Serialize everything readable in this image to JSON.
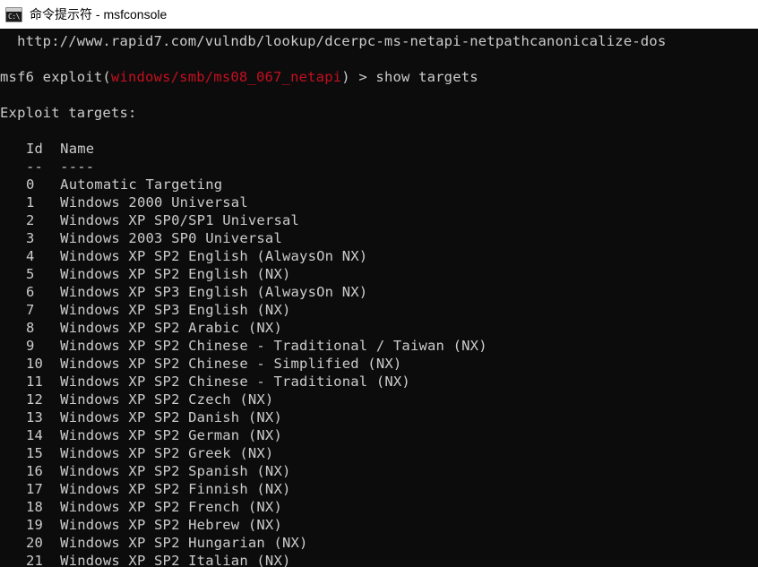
{
  "window": {
    "title": "命令提示符 - msfconsole",
    "icon": "cmd-icon",
    "icon_prompt_glyph": "C:\\",
    "titlebar_bg": "#ffffff",
    "titlebar_fg": "#000000"
  },
  "terminal": {
    "background": "#0c0c0c",
    "foreground": "#cccccc",
    "accent_red": "#c50f1f",
    "url_line": "  http://www.rapid7.com/vulndb/lookup/dcerpc-ms-netapi-netpathcanonicalize-dos",
    "prompt": {
      "prefix": "msf6 exploit(",
      "module": "windows/smb/ms08_067_netapi",
      "suffix": ") > ",
      "command": "show targets"
    },
    "section_title": "Exploit targets:",
    "table": {
      "headers": [
        "Id",
        "Name"
      ],
      "separators": [
        "--",
        "----"
      ],
      "rows": [
        {
          "id": "0",
          "name": "Automatic Targeting"
        },
        {
          "id": "1",
          "name": "Windows 2000 Universal"
        },
        {
          "id": "2",
          "name": "Windows XP SP0/SP1 Universal"
        },
        {
          "id": "3",
          "name": "Windows 2003 SP0 Universal"
        },
        {
          "id": "4",
          "name": "Windows XP SP2 English (AlwaysOn NX)"
        },
        {
          "id": "5",
          "name": "Windows XP SP2 English (NX)"
        },
        {
          "id": "6",
          "name": "Windows XP SP3 English (AlwaysOn NX)"
        },
        {
          "id": "7",
          "name": "Windows XP SP3 English (NX)"
        },
        {
          "id": "8",
          "name": "Windows XP SP2 Arabic (NX)"
        },
        {
          "id": "9",
          "name": "Windows XP SP2 Chinese - Traditional / Taiwan (NX)"
        },
        {
          "id": "10",
          "name": "Windows XP SP2 Chinese - Simplified (NX)"
        },
        {
          "id": "11",
          "name": "Windows XP SP2 Chinese - Traditional (NX)"
        },
        {
          "id": "12",
          "name": "Windows XP SP2 Czech (NX)"
        },
        {
          "id": "13",
          "name": "Windows XP SP2 Danish (NX)"
        },
        {
          "id": "14",
          "name": "Windows XP SP2 German (NX)"
        },
        {
          "id": "15",
          "name": "Windows XP SP2 Greek (NX)"
        },
        {
          "id": "16",
          "name": "Windows XP SP2 Spanish (NX)"
        },
        {
          "id": "17",
          "name": "Windows XP SP2 Finnish (NX)"
        },
        {
          "id": "18",
          "name": "Windows XP SP2 French (NX)"
        },
        {
          "id": "19",
          "name": "Windows XP SP2 Hebrew (NX)"
        },
        {
          "id": "20",
          "name": "Windows XP SP2 Hungarian (NX)"
        },
        {
          "id": "21",
          "name": "Windows XP SP2 Italian (NX)"
        }
      ]
    }
  }
}
